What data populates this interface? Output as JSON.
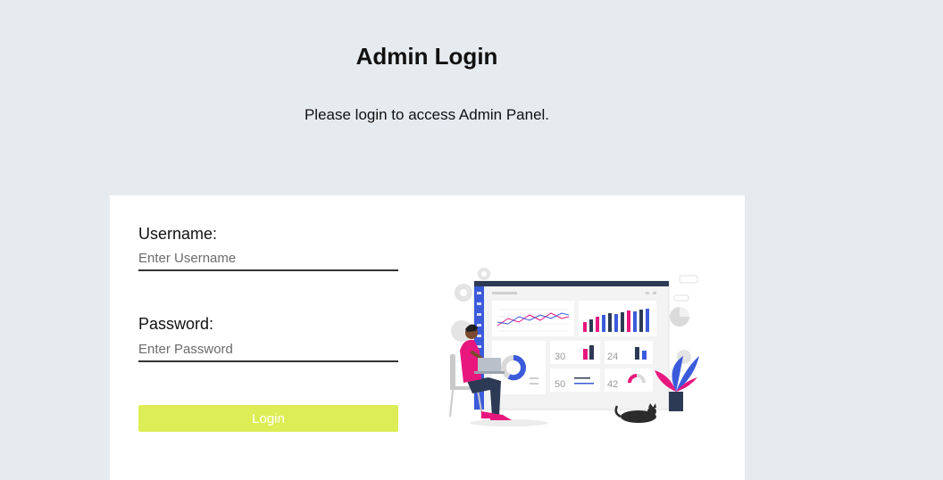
{
  "header": {
    "title": "Admin Login",
    "subtitle": "Please login to access Admin Panel."
  },
  "form": {
    "username_label": "Username:",
    "username_placeholder": "Enter Username",
    "username_value": "",
    "password_label": "Password:",
    "password_placeholder": "Enter Password",
    "password_value": "",
    "login_label": "Login"
  },
  "illustration": {
    "dashboard_stats": [
      "30",
      "24",
      "50",
      "42"
    ]
  },
  "colors": {
    "background": "#e6ebf0",
    "card": "#ffffff",
    "button": "#dced55",
    "accent_pink": "#e8177e",
    "accent_blue": "#3b5bdb",
    "dark_navy": "#2d3a55"
  }
}
